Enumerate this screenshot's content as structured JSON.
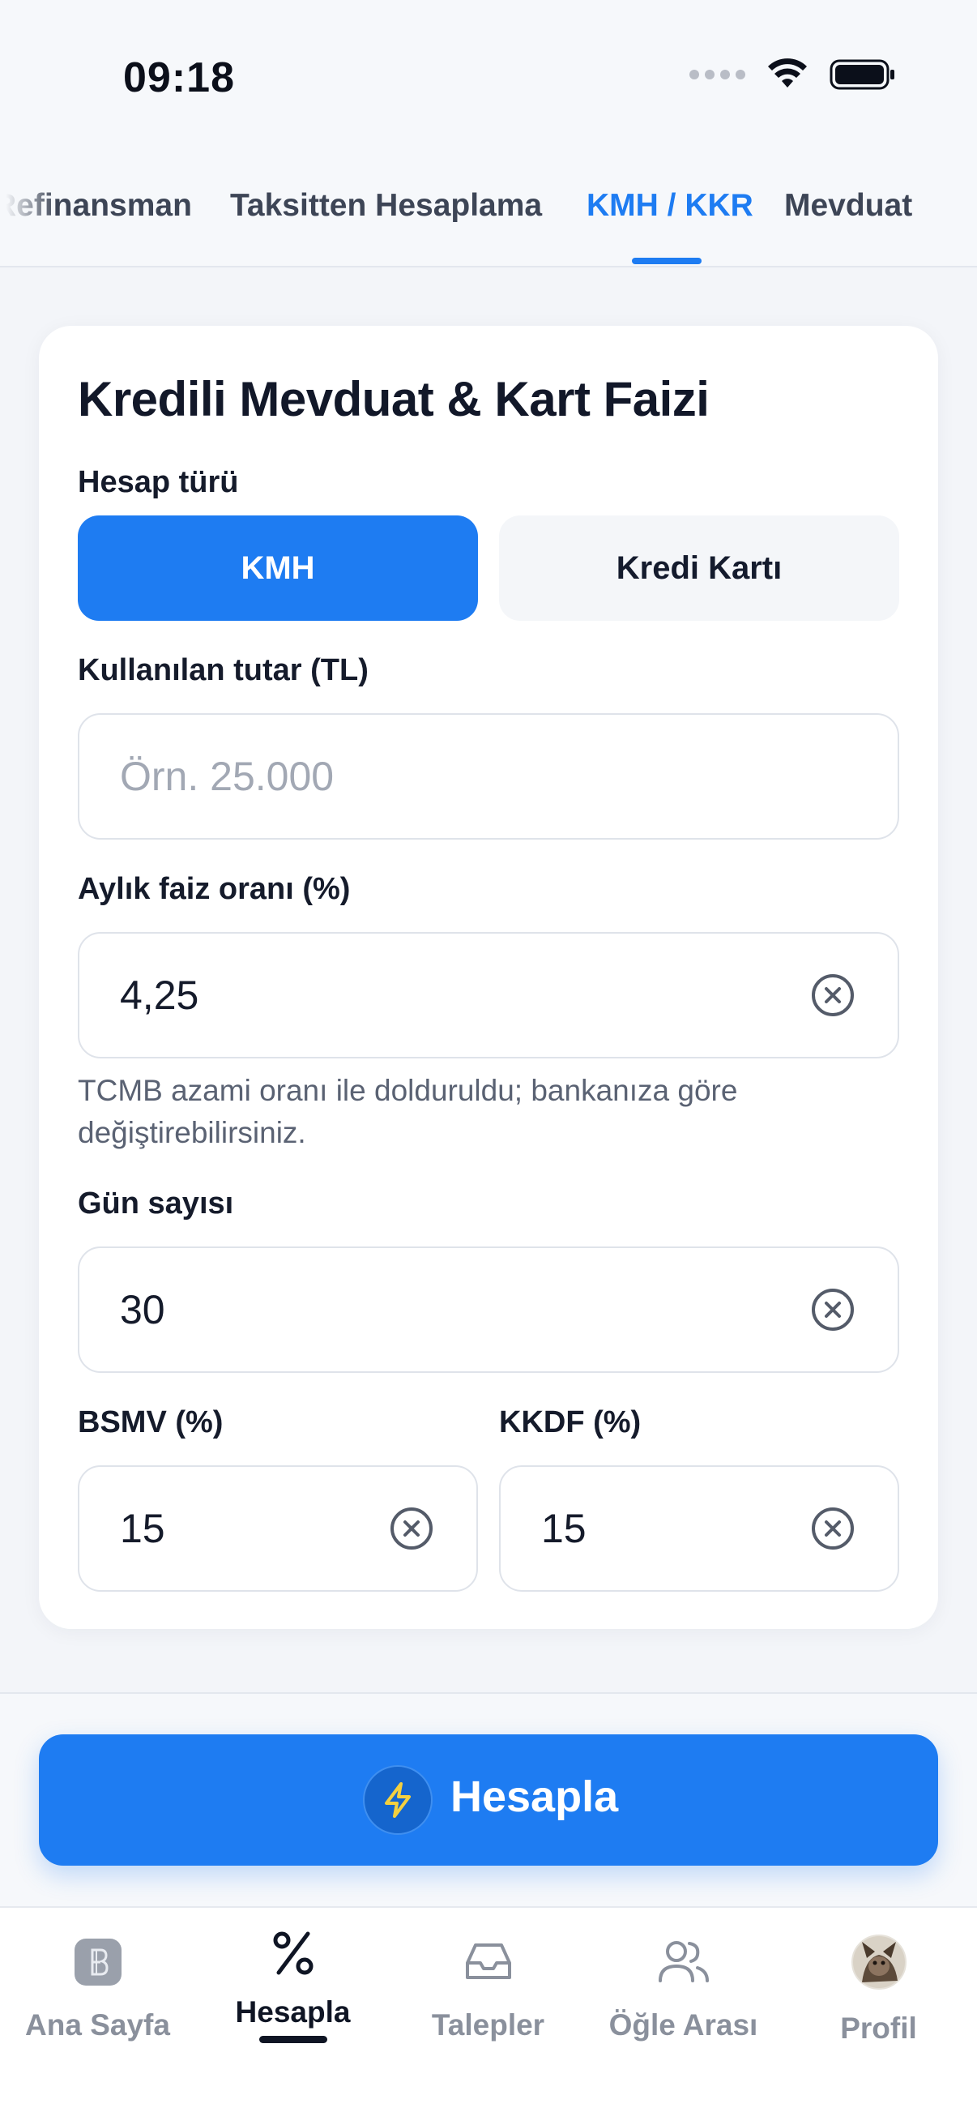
{
  "status_bar": {
    "time": "09:18",
    "icons": [
      "signal-dots-icon",
      "wifi-icon",
      "battery-icon"
    ]
  },
  "tabs": {
    "items": [
      {
        "label": "Refinansman"
      },
      {
        "label": "Taksitten Hesaplama"
      },
      {
        "label": "KMH / KKR"
      },
      {
        "label": "Mevduat"
      }
    ],
    "active_index": 2
  },
  "form": {
    "title": "Kredili Mevduat & Kart Faizi",
    "account_type": {
      "label": "Hesap türü",
      "options": [
        {
          "label": "KMH"
        },
        {
          "label": "Kredi Kartı"
        }
      ],
      "selected": "KMH"
    },
    "amount": {
      "label": "Kullanılan tutar (TL)",
      "value": "",
      "placeholder": "Örn. 25.000"
    },
    "monthly_rate": {
      "label": "Aylık faiz oranı (%)",
      "value": "4,25",
      "helper": "TCMB azami oranı ile dolduruldu; bankanıza göre değiştirebilirsiniz."
    },
    "days": {
      "label": "Gün sayısı",
      "value": "30"
    },
    "bsmv": {
      "label": "BSMV (%)",
      "value": "15"
    },
    "kkdf": {
      "label": "KKDF (%)",
      "value": "15"
    }
  },
  "action": {
    "label": "Hesapla",
    "icon": "lightning-icon"
  },
  "colors": {
    "accent": "#1e7cf2",
    "background": "#f3f5f9",
    "card": "#ffffff",
    "text": "#141b2d",
    "muted": "#8a909c"
  },
  "nav": {
    "items": [
      {
        "label": "Ana Sayfa",
        "icon": "bank-icon"
      },
      {
        "label": "Hesapla",
        "icon": "percent-icon"
      },
      {
        "label": "Talepler",
        "icon": "inbox-icon"
      },
      {
        "label": "Öğle Arası",
        "icon": "users-icon"
      },
      {
        "label": "Profil",
        "icon": "avatar"
      }
    ],
    "active_index": 1
  }
}
